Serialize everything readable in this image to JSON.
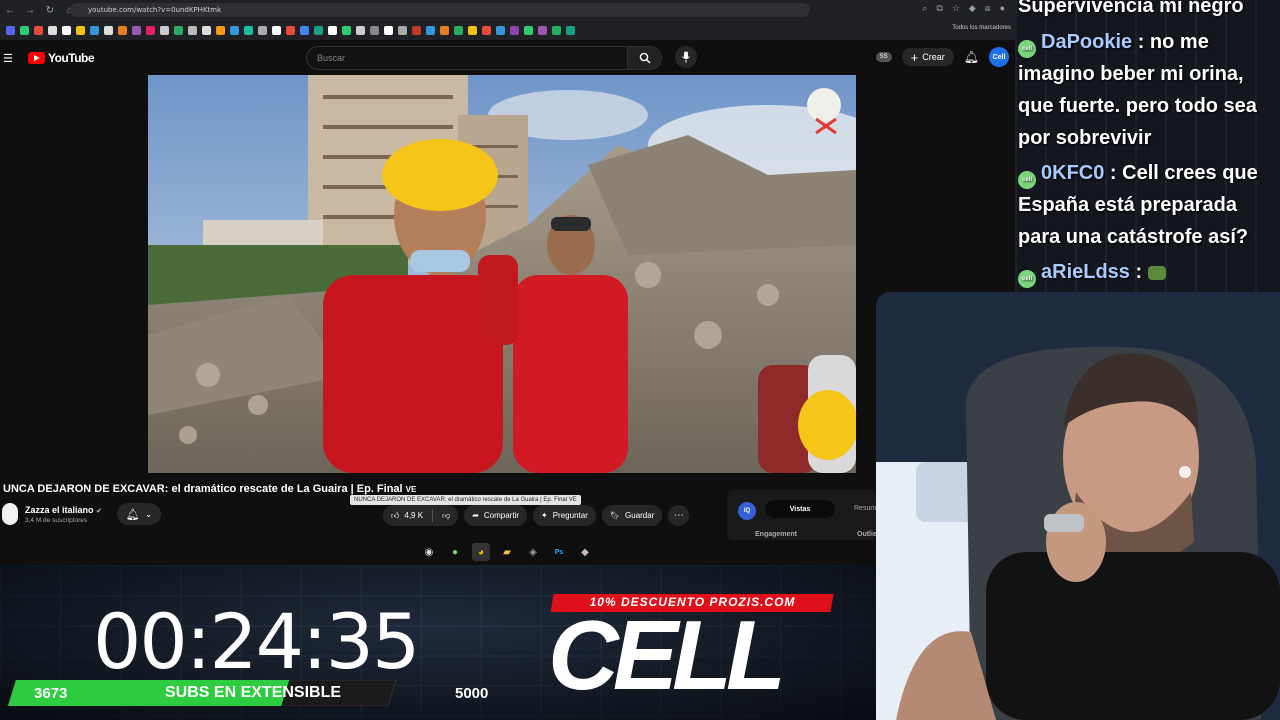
{
  "browser": {
    "url": "youtube.com/watch?v=0undKPHKtmk",
    "bookmarks_folder": "Todos los marcadores",
    "bookmark_colors": [
      "#5865f2",
      "#2ecc71",
      "#e74c3c",
      "#ddd",
      "#fff",
      "#f1c40f",
      "#3498db",
      "#ddd",
      "#e67e22",
      "#9b59b6",
      "#e91e63",
      "#ccc",
      "#27ae60",
      "#bbb",
      "#ddd",
      "#f39c12",
      "#3498db",
      "#1abc9c",
      "#aaa",
      "#fff",
      "#e74c3c",
      "#4285f4",
      "#16a085",
      "#fff",
      "#2ecc71",
      "#ccc",
      "#888",
      "#fff",
      "#aaa",
      "#c0392b",
      "#3498db",
      "#e67e22",
      "#27ae60",
      "#f1c40f",
      "#e74c3c",
      "#3498db",
      "#8e44ad",
      "#2ecc71",
      "#9b59b6",
      "#27ae60",
      "#16a085"
    ]
  },
  "youtube": {
    "brand": "YouTube",
    "search_placeholder": "Buscar",
    "badge": "SS",
    "create_label": "Crear",
    "avatar_text": "Cell",
    "video": {
      "title": "UNCA DEJARON DE EXCAVAR: el dramático rescate de La Guaira | Ep. Final",
      "title_suffix": "VE",
      "tooltip": "NUNCA DEJARON DE EXCAVAR: el dramático rescate de La Guaira | Ep. Final VE",
      "channel": "Zazza el italiano",
      "subscribers": "3,4 M de suscriptores",
      "likes": "4,9 K",
      "share": "Compartir",
      "ask": "Preguntar",
      "save": "Guardar"
    },
    "panel": {
      "logo": "IQ",
      "tab_active": "Vistas",
      "tab_other": "Resum",
      "engagement": "Engagement",
      "outlier": "Outlie"
    }
  },
  "overlay": {
    "timer": "00:24:35",
    "subs_current": "3673",
    "subs_label": "SUBS EN EXTENSIBLE",
    "subs_goal": "5000",
    "subs_progress": 0.7346,
    "promo": "10% DESCUENTO PROZIS.COM",
    "logo": "CELL"
  },
  "chat": {
    "messages": [
      {
        "user": "",
        "text": "Supervivencia mi negro"
      },
      {
        "user": "DaPookie",
        "text": ": no me imagino beber mi orina, que fuerte. pero todo sea por sobrevivir"
      },
      {
        "user": "0KFC0",
        "text": ": Cell crees que España está preparada para una catástrofe así?"
      },
      {
        "user": "aRieLdss",
        "text": ":"
      }
    ]
  }
}
